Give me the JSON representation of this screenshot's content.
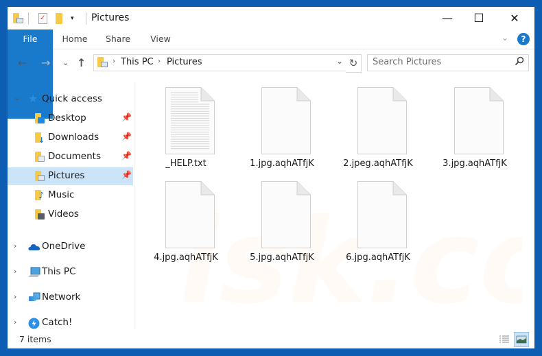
{
  "window": {
    "title": "Pictures",
    "controls": {
      "minimize": "—",
      "maximize": "☐",
      "close": "✕"
    }
  },
  "quick_access_toolbar": {
    "icons": [
      "pictures-folder-icon",
      "properties-icon",
      "new-folder-icon",
      "customize-dropdown-icon"
    ]
  },
  "ribbon": {
    "tabs": [
      {
        "label": "File",
        "active": true
      },
      {
        "label": "Home"
      },
      {
        "label": "Share"
      },
      {
        "label": "View"
      }
    ],
    "expand_icon": "⌄",
    "help_icon": "?"
  },
  "navigation": {
    "back": "←",
    "forward": "→",
    "recent": "⌄",
    "up": "↑"
  },
  "address_bar": {
    "breadcrumbs": [
      "This PC",
      "Pictures"
    ],
    "separator": "›",
    "dropdown": "⌄",
    "refresh": "↻"
  },
  "search": {
    "placeholder": "Search Pictures",
    "icon": "⚲"
  },
  "nav_pane": {
    "quick_access": {
      "label": "Quick access",
      "expanded": true,
      "items": [
        {
          "label": "Desktop",
          "pinned": true
        },
        {
          "label": "Downloads",
          "pinned": true
        },
        {
          "label": "Documents",
          "pinned": true
        },
        {
          "label": "Pictures",
          "pinned": true,
          "selected": true
        },
        {
          "label": "Music",
          "pinned": false
        },
        {
          "label": "Videos",
          "pinned": false
        }
      ]
    },
    "roots": [
      {
        "label": "OneDrive"
      },
      {
        "label": "This PC"
      },
      {
        "label": "Network"
      },
      {
        "label": "Catch!"
      }
    ],
    "pin_glyph": "📌",
    "chevron_down": "⌄",
    "chevron_right": "›"
  },
  "files": [
    {
      "name": "_HELP.txt",
      "type": "text"
    },
    {
      "name": "1.jpg.aqhATfjK",
      "type": "blank"
    },
    {
      "name": "2.jpeg.aqhATfjK",
      "type": "blank"
    },
    {
      "name": "3.jpg.aqhATfjK",
      "type": "blank"
    },
    {
      "name": "4.jpg.aqhATfjK",
      "type": "blank"
    },
    {
      "name": "5.jpg.aqhATfjK",
      "type": "blank"
    },
    {
      "name": "6.jpg.aqhATfjK",
      "type": "blank"
    }
  ],
  "status_bar": {
    "item_count": "7 items",
    "views": [
      "details-view",
      "large-icons-view"
    ],
    "active_view": "large-icons-view"
  },
  "colors": {
    "accent": "#1979ca",
    "frame": "#0d5db3",
    "selection": "#cce4f7",
    "folder": "#f7c948"
  }
}
